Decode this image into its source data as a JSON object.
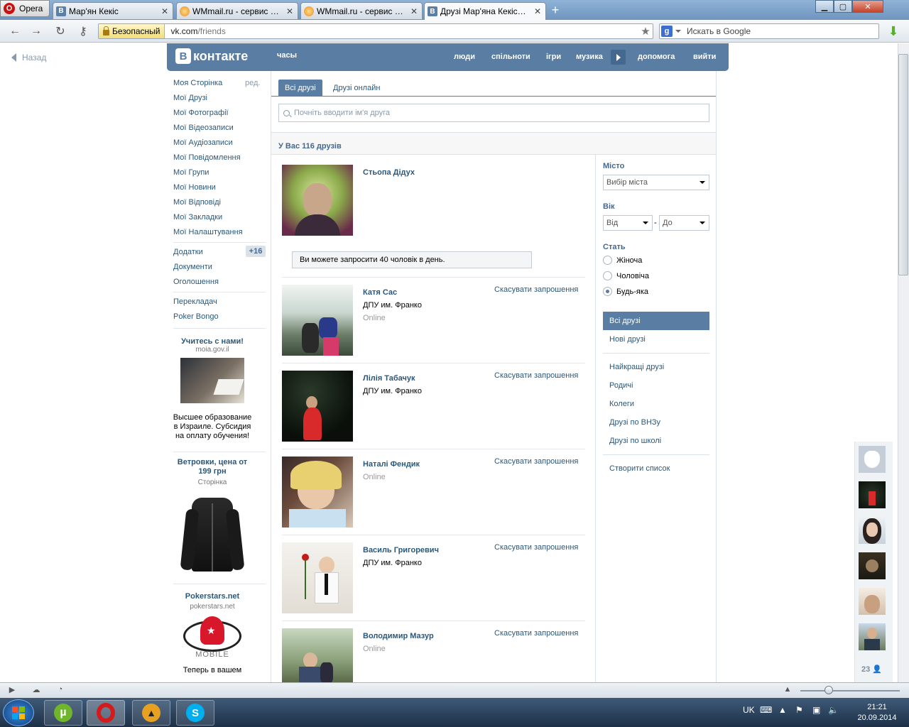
{
  "browser": {
    "menu_label": "Opera",
    "tabs": [
      {
        "title": "Мар'ян Кекіс",
        "fav": "vk"
      },
      {
        "title": "WMmail.ru - сервис п...",
        "fav": "wm"
      },
      {
        "title": "WMmail.ru - сервис п...",
        "fav": "wm"
      },
      {
        "title": "Друзі Мар'яна Кекіса |...",
        "fav": "vk",
        "active": true
      }
    ],
    "secure_label": "Безопасный",
    "url_host": "vk.com",
    "url_path": "/friends",
    "search_placeholder": "Искать в Google"
  },
  "vk": {
    "back_label": "Назад",
    "logo_letter": "В",
    "logo_text": "контакте",
    "search_label": "часы",
    "top_nav": [
      "люди",
      "спільноти",
      "ігри",
      "музика",
      "допомога",
      "вийти"
    ],
    "left_menu": {
      "edit_label": "ред.",
      "group1": [
        "Моя Сторінка",
        "Мої Друзі",
        "Мої Фотографії",
        "Мої Відеозаписи",
        "Мої Аудіозаписи",
        "Мої Повідомлення",
        "Мої Групи",
        "Мої Новини",
        "Мої Відповіді",
        "Мої Закладки",
        "Мої Налаштування"
      ],
      "group2": [
        "Додатки",
        "Документи",
        "Оголошення"
      ],
      "apps_badge": "+16",
      "group3": [
        "Перекладач",
        "Poker Bongo"
      ]
    },
    "ads": [
      {
        "title": "Учитесь с нами!",
        "sub": "moia.gov.il",
        "text": "Высшее образование в Израиле. Субсидия на оплату обучения!"
      },
      {
        "title": "Ветровки, цена от 199 грн",
        "sub": "Сторінка"
      },
      {
        "title": "Pokerstars.net",
        "sub": "pokerstars.net",
        "text": "Теперь в вашем",
        "logo_word": "MOBILE"
      }
    ],
    "tabs": [
      "Всі друзі",
      "Друзі онлайн"
    ],
    "friend_search_placeholder": "Почніть вводити ім'я друга",
    "friends_count": "У Вас 116 друзів",
    "invite_notice": "Ви можете запросити 40 чоловік в день.",
    "friends": [
      {
        "name": "Стьопа Дідух"
      },
      {
        "name": "Катя Сас",
        "sub": "ДПУ им. Франко",
        "online": "Online",
        "action": "Скасувати запрошення"
      },
      {
        "name": "Лілія Табачук",
        "sub": "ДПУ им. Франко",
        "action": "Скасувати запрошення"
      },
      {
        "name": "Наталі Фендик",
        "online": "Online",
        "action": "Скасувати запрошення"
      },
      {
        "name": "Василь Григоревич",
        "sub": "ДПУ им. Франко",
        "action": "Скасувати запрошення"
      },
      {
        "name": "Володимир Мазур",
        "online": "Online",
        "action": "Скасувати запрошення"
      }
    ],
    "filters": {
      "city_label": "Місто",
      "city_select": "Вибір міста",
      "age_label": "Вік",
      "age_from": "Від",
      "age_to": "До",
      "age_dash": "-",
      "sex_label": "Стать",
      "sex_options": [
        "Жіноча",
        "Чоловіча",
        "Будь-яка"
      ],
      "sex_selected": 2,
      "lists_active": "Всі друзі",
      "lists": [
        "Нові друзі"
      ],
      "lists2": [
        "Найкращі друзі",
        "Родичі",
        "Колеги",
        "Друзі по ВНЗу",
        "Друзі по школі"
      ],
      "create_list": "Створити список"
    },
    "chat_count": "23"
  },
  "taskbar": {
    "lang": "UK",
    "time": "21:21",
    "date": "20.09.2014"
  },
  "colors": {
    "vk_blue": "#597da3",
    "vk_link": "#2b587a",
    "vk_title": "#45688e"
  }
}
